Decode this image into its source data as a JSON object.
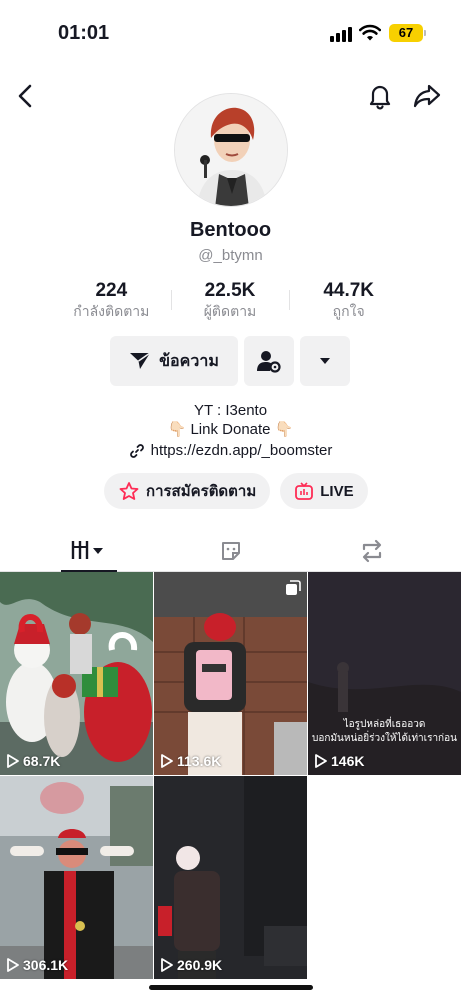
{
  "status_bar": {
    "time": "01:01",
    "battery": "67"
  },
  "profile": {
    "name": "Bentooo",
    "handle": "@_btymn",
    "stats": [
      {
        "value": "224",
        "label": "กำลังติดตาม"
      },
      {
        "value": "22.5K",
        "label": "ผู้ติดตาม"
      },
      {
        "value": "44.7K",
        "label": "ถูกใจ"
      }
    ],
    "message_label": "ข้อความ",
    "bio_line1": "YT : I3ento",
    "bio_line2": "👇🏻 Link Donate 👇🏻",
    "link": "https://ezdn.app/_boomster",
    "subscribe_label": "การสมัครติดตาม",
    "live_label": "LIVE"
  },
  "colors": {
    "accent": "#fe2c55",
    "text": "#161823",
    "muted": "#8a8b91",
    "button_bg": "#f1f1f2"
  },
  "videos": [
    {
      "views": "68.7K"
    },
    {
      "views": "113.6K"
    },
    {
      "views": "146K",
      "caption_line1": "ไอรูปหล่อที่เธออวด",
      "caption_line2": "บอกมันหน่อยิ่ร่วงให้ได้เท่าเราก่อน"
    },
    {
      "views": "306.1K"
    },
    {
      "views": "260.9K"
    }
  ]
}
